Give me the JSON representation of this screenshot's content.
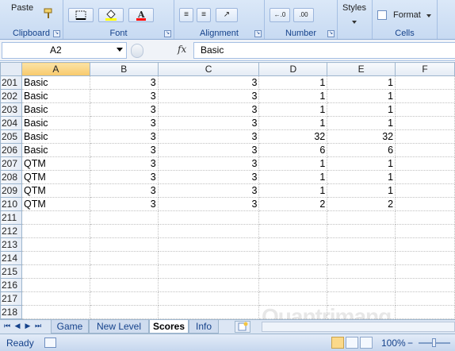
{
  "ribbon": {
    "paste_label": "Paste",
    "clipboard_label": "Clipboard",
    "font_label": "Font",
    "alignment_label": "Alignment",
    "number_label": "Number",
    "styles_label": "Styles",
    "format_label": "Format",
    "cells_label": "Cells",
    "font_color": "#ff0000",
    "fill_color": "#ffff00"
  },
  "formula_bar": {
    "name_box": "A2",
    "fx_label": "fx",
    "formula": "Basic"
  },
  "grid": {
    "columns": [
      "A",
      "B",
      "C",
      "D",
      "E",
      "F"
    ],
    "selected_column": "A",
    "rows": [
      {
        "num": "201",
        "cells": [
          "Basic",
          "3",
          "3",
          "1",
          "1"
        ]
      },
      {
        "num": "202",
        "cells": [
          "Basic",
          "3",
          "3",
          "1",
          "1"
        ]
      },
      {
        "num": "203",
        "cells": [
          "Basic",
          "3",
          "3",
          "1",
          "1"
        ]
      },
      {
        "num": "204",
        "cells": [
          "Basic",
          "3",
          "3",
          "1",
          "1"
        ]
      },
      {
        "num": "205",
        "cells": [
          "Basic",
          "3",
          "3",
          "32",
          "32"
        ]
      },
      {
        "num": "206",
        "cells": [
          "Basic",
          "3",
          "3",
          "6",
          "6"
        ]
      },
      {
        "num": "207",
        "cells": [
          "QTM",
          "3",
          "3",
          "1",
          "1"
        ]
      },
      {
        "num": "208",
        "cells": [
          "QTM",
          "3",
          "3",
          "1",
          "1"
        ]
      },
      {
        "num": "209",
        "cells": [
          "QTM",
          "3",
          "3",
          "1",
          "1"
        ]
      },
      {
        "num": "210",
        "cells": [
          "QTM",
          "3",
          "3",
          "2",
          "2"
        ]
      },
      {
        "num": "211",
        "cells": [
          "",
          "",
          "",
          "",
          ""
        ]
      },
      {
        "num": "212",
        "cells": [
          "",
          "",
          "",
          "",
          ""
        ]
      },
      {
        "num": "213",
        "cells": [
          "",
          "",
          "",
          "",
          ""
        ]
      },
      {
        "num": "214",
        "cells": [
          "",
          "",
          "",
          "",
          ""
        ]
      },
      {
        "num": "215",
        "cells": [
          "",
          "",
          "",
          "",
          ""
        ]
      },
      {
        "num": "216",
        "cells": [
          "",
          "",
          "",
          "",
          ""
        ]
      },
      {
        "num": "217",
        "cells": [
          "",
          "",
          "",
          "",
          ""
        ]
      },
      {
        "num": "218",
        "cells": [
          "",
          "",
          "",
          "",
          ""
        ]
      }
    ]
  },
  "sheet_tabs": {
    "tabs": [
      {
        "label": "Game"
      },
      {
        "label": "New Level"
      },
      {
        "label": "Scores"
      },
      {
        "label": "Info"
      }
    ],
    "active": "Scores"
  },
  "status_bar": {
    "status": "Ready",
    "zoom": "100%",
    "zoom_minus": "−"
  },
  "watermark": "Quantrimang"
}
